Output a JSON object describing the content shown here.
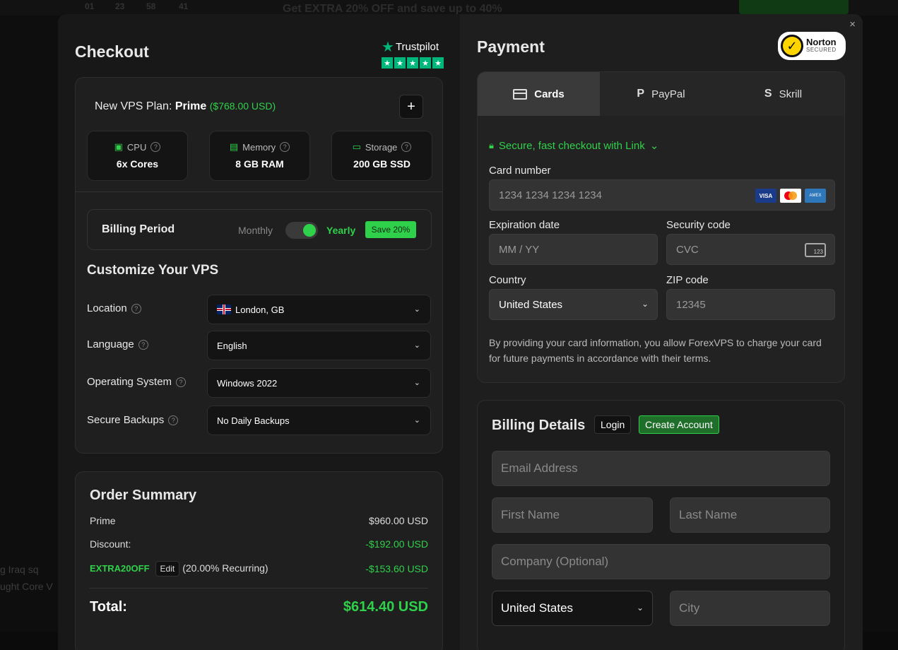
{
  "background": {
    "counts": [
      "01",
      "23",
      "58",
      "41"
    ],
    "promo": "Get EXTRA 20% OFF and save up to 40%",
    "side_text_1": "g Iraq sq",
    "side_text_2": "ught Core V"
  },
  "modal": {
    "close": "×"
  },
  "checkout": {
    "title": "Checkout",
    "trustpilot": "Trustpilot",
    "plan_prefix": "New VPS Plan: ",
    "plan_name": "Prime",
    "plan_price": "($768.00 USD)",
    "add_btn": "+",
    "specs": [
      {
        "label": "CPU",
        "value": "6x Cores"
      },
      {
        "label": "Memory",
        "value": "8 GB RAM"
      },
      {
        "label": "Storage",
        "value": "200 GB SSD"
      }
    ],
    "billing_period": {
      "label": "Billing Period",
      "monthly": "Monthly",
      "yearly": "Yearly",
      "save": "Save 20%",
      "selected": "Yearly"
    },
    "customize_title": "Customize Your VPS",
    "options": [
      {
        "label": "Location",
        "value": "London, GB"
      },
      {
        "label": "Language",
        "value": "English"
      },
      {
        "label": "Operating System",
        "value": "Windows 2022"
      },
      {
        "label": "Secure Backups",
        "value": "No Daily Backups"
      }
    ]
  },
  "summary": {
    "title": "Order Summary",
    "rows": [
      {
        "label": "Prime",
        "value": "$960.00 USD"
      },
      {
        "label": "Discount:",
        "value": "-$192.00 USD"
      }
    ],
    "coupon": {
      "code": "EXTRA20OFF",
      "edit": "Edit",
      "note": "(20.00% Recurring)",
      "value": "-$153.60 USD"
    },
    "total_label": "Total:",
    "total_value": "$614.40 USD"
  },
  "payment": {
    "title": "Payment",
    "norton": "Norton",
    "norton_sub": "SECURED",
    "tabs": [
      "Cards",
      "PayPal",
      "Skrill"
    ],
    "active_tab": "Cards",
    "link_text": "Secure, fast checkout with Link",
    "card_number_label": "Card number",
    "card_number_placeholder": "1234 1234 1234 1234",
    "expiry_label": "Expiration date",
    "expiry_placeholder": "MM / YY",
    "security_label": "Security code",
    "security_placeholder": "CVC",
    "country_label": "Country",
    "country_value": "United States",
    "zip_label": "ZIP code",
    "zip_placeholder": "12345",
    "terms": "By providing your card information, you allow ForexVPS to charge your card for future payments in accordance with their terms.",
    "card_brands": {
      "visa": "VISA",
      "amex": "AMEX",
      "cvc_digits": "123"
    }
  },
  "billing": {
    "title": "Billing Details",
    "login": "Login",
    "create": "Create Account",
    "email_placeholder": "Email Address",
    "first_placeholder": "First Name",
    "last_placeholder": "Last Name",
    "company_placeholder": "Company (Optional)",
    "country_value": "United States",
    "city_placeholder": "City"
  },
  "colors": {
    "accent_green": "#2fd14a",
    "trustpilot_green": "#00b67a",
    "panel_bg": "#1c1c1c"
  }
}
